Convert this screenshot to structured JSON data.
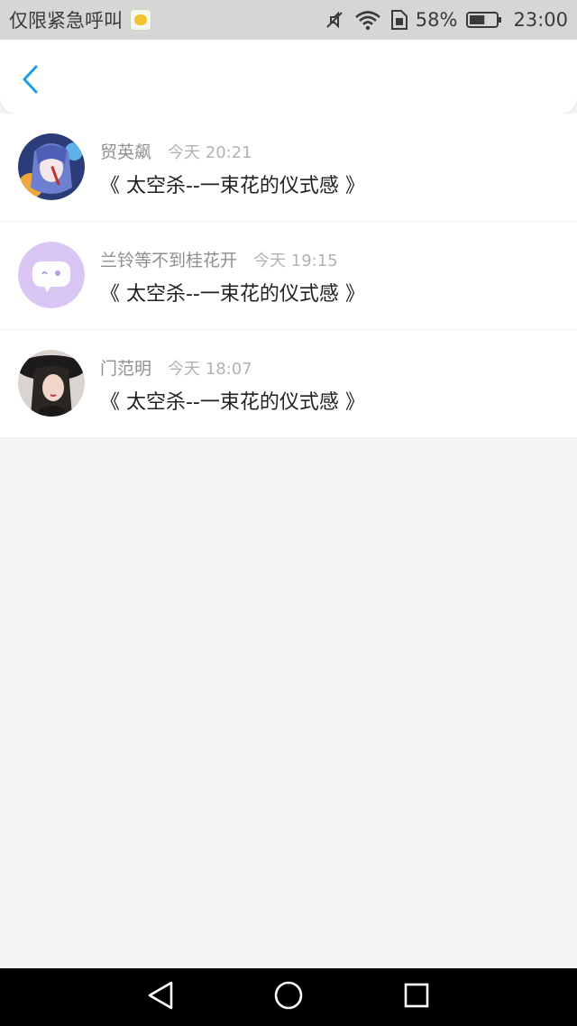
{
  "status_bar": {
    "carrier": "仅限紧急呼叫",
    "battery_percent": "58%",
    "time": "23:00",
    "battery_level": 0.58
  },
  "header": {
    "back_icon": "chevron-left-icon",
    "accent": "#1a9fe0"
  },
  "list": {
    "items": [
      {
        "author": "贸英飙",
        "time": "今天 20:21",
        "title": "《 太空杀--一束花的仪式感 》",
        "avatar": "anime-avatar"
      },
      {
        "author": "兰铃等不到桂花开",
        "time": "今天 19:15",
        "title": "《 太空杀--一束花的仪式感 》",
        "avatar": "chat-bubble-avatar"
      },
      {
        "author": "门范明",
        "time": "今天 18:07",
        "title": "《 太空杀--一束花的仪式感 》",
        "avatar": "photo-avatar"
      }
    ]
  },
  "nav_bar": {
    "back_icon": "triangle-back-icon",
    "home_icon": "circle-home-icon",
    "recent_icon": "square-recent-icon"
  }
}
